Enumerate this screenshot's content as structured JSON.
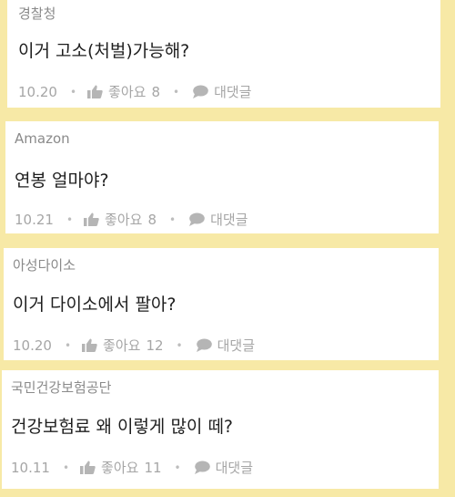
{
  "colors": {
    "background": "#f7e9a6",
    "card": "#ffffff",
    "meta_text": "#a6a6a6",
    "author_text": "#8a8a8a"
  },
  "posts": [
    {
      "author": "경찰청",
      "body": "이거 고소(처벌)가능해?",
      "date": "10.20",
      "like_label": "좋아요",
      "like_count": "8",
      "reply_label": "대댓글"
    },
    {
      "author": "Amazon",
      "body": "연봉 얼마야?",
      "date": "10.21",
      "like_label": "좋아요",
      "like_count": "8",
      "reply_label": "대댓글"
    },
    {
      "author": "아성다이소",
      "body": "이거 다이소에서 팔아?",
      "date": "10.20",
      "like_label": "좋아요",
      "like_count": "12",
      "reply_label": "대댓글"
    },
    {
      "author": "국민건강보험공단",
      "body": "건강보험료 왜 이렇게 많이 떼?",
      "date": "10.11",
      "like_label": "좋아요",
      "like_count": "11",
      "reply_label": "대댓글"
    }
  ],
  "icons": {
    "like": "thumbs-up-icon",
    "reply": "speech-bubble-icon"
  }
}
